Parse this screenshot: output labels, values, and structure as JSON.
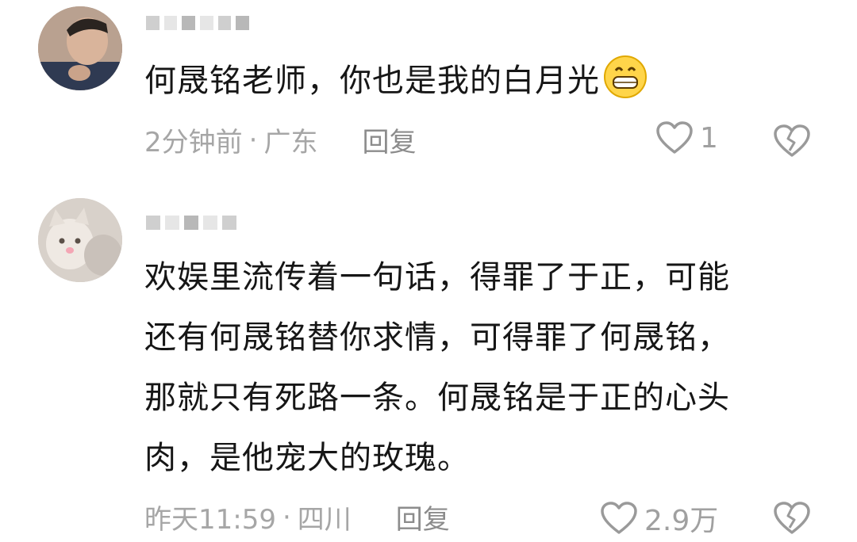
{
  "comments": [
    {
      "text": "何晟铭老师，你也是我的白月光",
      "time": "2分钟前",
      "location": "广东",
      "reply_label": "回复",
      "like_count": "1"
    },
    {
      "text": "欢娱里流传着一句话，得罪了于正，可能\n还有何晟铭替你求情，可得罪了何晟铭，\n那就只有死路一条。何晟铭是于正的心头\n肉，是他宠大的玫瑰。",
      "time": "昨天11:59",
      "location": "四川",
      "reply_label": "回复",
      "like_count": "2.9万"
    }
  ],
  "separator": "·",
  "icons": {
    "like": "heart-outline-icon",
    "dislike": "broken-heart-icon",
    "emoji": "grinning-face-emoji-icon"
  },
  "colors": {
    "text": "#161616",
    "meta": "#a6a6a6",
    "icon": "#9a9a9a"
  }
}
